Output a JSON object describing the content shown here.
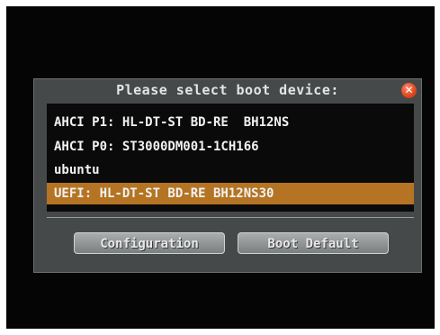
{
  "dialog": {
    "title": "Please select boot device:",
    "close_icon": "close-icon"
  },
  "boot_devices": [
    {
      "label": "AHCI P1: HL-DT-ST BD-RE  BH12NS"
    },
    {
      "label": "AHCI P0: ST3000DM001-1CH166"
    },
    {
      "label": "ubuntu"
    },
    {
      "label": "UEFI: HL-DT-ST BD-RE BH12NS30",
      "selected": true
    }
  ],
  "buttons": {
    "configuration": "Configuration",
    "boot_default": "Boot Default"
  },
  "colors": {
    "highlight": "#b47423",
    "dialog_bg": "#46494a",
    "list_bg": "#0a0a0a",
    "close": "#e04a22"
  }
}
